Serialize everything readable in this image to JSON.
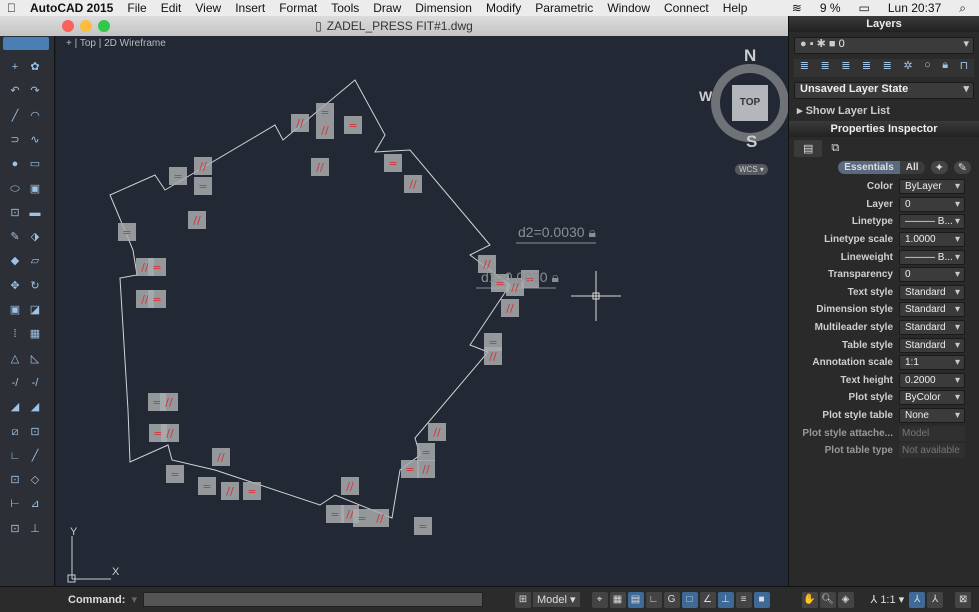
{
  "menubar": {
    "app": "AutoCAD 2015",
    "items": [
      "File",
      "Edit",
      "View",
      "Insert",
      "Format",
      "Tools",
      "Draw",
      "Dimension",
      "Modify",
      "Parametric",
      "Window",
      "Connect",
      "Help"
    ],
    "battery": "9 %",
    "clock": "Lun 20:37"
  },
  "window": {
    "title": "ZADEL_PRESS FIT#1.dwg",
    "view_label": "+ | Top | 2D Wireframe"
  },
  "viewcube": {
    "north": "N",
    "south": "S",
    "west": "W",
    "face": "TOP",
    "wcs": "WCS"
  },
  "drawing": {
    "dim1": "d1=0.0030",
    "dim2": "d2=0.0030",
    "ucs_y": "Y",
    "ucs_x": "X"
  },
  "layers": {
    "title": "Layers",
    "current": "0",
    "layer_state": "Unsaved Layer State",
    "show_list": "Show Layer List"
  },
  "properties": {
    "title": "Properties Inspector",
    "tabs": [
      "Essentials",
      "All"
    ],
    "rows": [
      {
        "label": "Color",
        "value": "ByLayer"
      },
      {
        "label": "Layer",
        "value": "0"
      },
      {
        "label": "Linetype",
        "value": "——— B..."
      },
      {
        "label": "Linetype scale",
        "value": "1.0000"
      },
      {
        "label": "Lineweight",
        "value": "——— B..."
      },
      {
        "label": "Transparency",
        "value": "0"
      },
      {
        "label": "Text style",
        "value": "Standard"
      },
      {
        "label": "Dimension style",
        "value": "Standard"
      },
      {
        "label": "Multileader style",
        "value": "Standard"
      },
      {
        "label": "Table style",
        "value": "Standard"
      },
      {
        "label": "Annotation scale",
        "value": "1:1"
      },
      {
        "label": "Text height",
        "value": "0.2000"
      },
      {
        "label": "Plot style",
        "value": "ByColor"
      },
      {
        "label": "Plot style table",
        "value": "None"
      },
      {
        "label": "Plot style attache...",
        "value": "Model"
      },
      {
        "label": "Plot table type",
        "value": "Not available"
      }
    ]
  },
  "command": {
    "label": "Command:",
    "input": ""
  },
  "status": {
    "model": "Model",
    "anno_scale": "1:1"
  }
}
